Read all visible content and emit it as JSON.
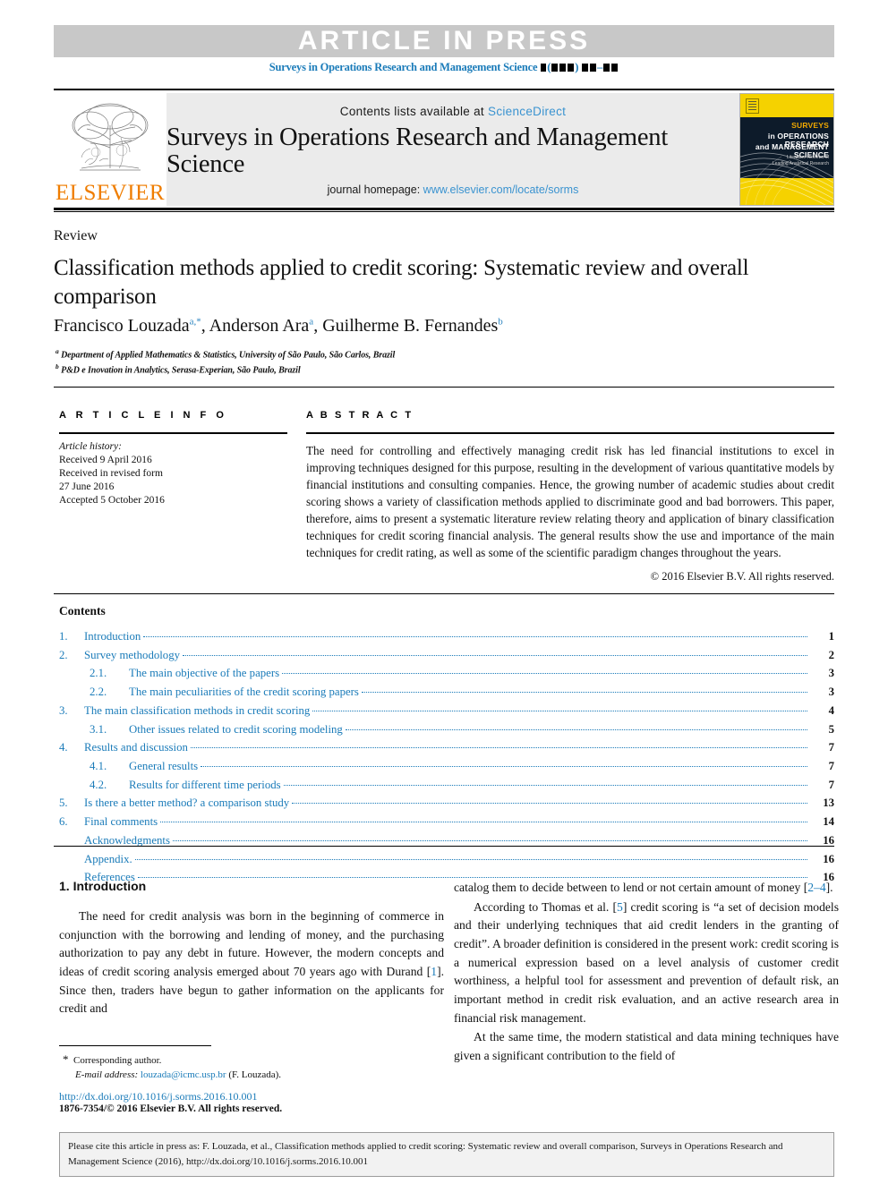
{
  "banner": {
    "text": "ARTICLE IN PRESS",
    "journal_ref_prefix": "Surveys in Operations Research and Management Science",
    "journal_ref_suffix_note": "volume/issue/page placeholders shown as black blocks",
    "band_color": "#c8c8c8",
    "link_color": "#1a7bb9"
  },
  "masthead": {
    "contents_available_prefix": "Contents lists available at ",
    "sciencedirect": "ScienceDirect",
    "journal_title": "Surveys in Operations Research and Management Science",
    "homepage_prefix": "journal homepage: ",
    "homepage_url": "www.elsevier.com/locate/sorms",
    "publisher": "ELSEVIER",
    "publisher_color": "#ef7d00",
    "cover": {
      "line1": "SURVEYS",
      "line2": "in OPERATIONS RESEARCH",
      "line3": "and MANAGEMENT SCIENCE",
      "subline1": "Literature Reviews of",
      "subline2": "Leading Analytical Research",
      "bg_color": "#f5d200",
      "band_color": "#0d1b2a"
    }
  },
  "article": {
    "type_label": "Review",
    "title": "Classification methods applied to credit scoring: Systematic review and overall comparison",
    "authors": [
      {
        "name": "Francisco Louzada",
        "marks": "a,*"
      },
      {
        "name": "Anderson Ara",
        "marks": "a"
      },
      {
        "name": "Guilherme B. Fernandes",
        "marks": "b"
      }
    ],
    "affiliations": [
      {
        "mark": "a",
        "text": "Department of Applied Mathematics & Statistics, University of São Paulo, São Carlos, Brazil"
      },
      {
        "mark": "b",
        "text": "P&D e Inovation in Analytics, Serasa-Experian, São Paulo, Brazil"
      }
    ]
  },
  "article_info": {
    "heading": "A R T I C L E  I N F O",
    "history_label": "Article history:",
    "lines": [
      "Received 9 April 2016",
      "Received in revised form",
      "27 June 2016",
      "Accepted 5 October 2016"
    ]
  },
  "abstract": {
    "heading": "A B S T R A C T",
    "text": "The need for controlling and effectively managing credit risk has led financial institutions to excel in improving techniques designed for this purpose, resulting in the development of various quantitative models by financial institutions and consulting companies. Hence, the growing number of academic studies about credit scoring shows a variety of classification methods applied to discriminate good and bad borrowers. This paper, therefore, aims to present a systematic literature review relating theory and application of binary classification techniques for credit scoring financial analysis. The general results show the use and importance of the main techniques for credit rating, as well as some of the scientific paradigm changes throughout the years.",
    "copyright": "© 2016 Elsevier B.V. All rights reserved."
  },
  "contents": {
    "heading": "Contents",
    "items": [
      {
        "num": "1.",
        "level": 1,
        "label": "Introduction",
        "page": "1"
      },
      {
        "num": "2.",
        "level": 1,
        "label": "Survey methodology",
        "page": "2"
      },
      {
        "num": "2.1.",
        "level": 2,
        "label": "The main objective of the papers",
        "page": "3"
      },
      {
        "num": "2.2.",
        "level": 2,
        "label": "The main peculiarities of the credit scoring papers",
        "page": "3"
      },
      {
        "num": "3.",
        "level": 1,
        "label": "The main classification methods in credit scoring",
        "page": "4"
      },
      {
        "num": "3.1.",
        "level": 2,
        "label": "Other issues related to credit scoring modeling",
        "page": "5"
      },
      {
        "num": "4.",
        "level": 1,
        "label": "Results and discussion",
        "page": "7"
      },
      {
        "num": "4.1.",
        "level": 2,
        "label": "General results",
        "page": "7"
      },
      {
        "num": "4.2.",
        "level": 2,
        "label": "Results for different time periods",
        "page": "7"
      },
      {
        "num": "5.",
        "level": 1,
        "label": "Is there a better method? a comparison study",
        "page": "13"
      },
      {
        "num": "6.",
        "level": 1,
        "label": "Final comments",
        "page": "14"
      },
      {
        "num": "",
        "level": 1,
        "label": "Acknowledgments",
        "page": "16"
      },
      {
        "num": "",
        "level": 1,
        "label": "Appendix.",
        "page": "16"
      },
      {
        "num": "",
        "level": 1,
        "label": "References",
        "page": "16"
      }
    ]
  },
  "body": {
    "section_heading": "1. Introduction",
    "left_paragraph_1_a": "The need for credit analysis was born in the beginning of commerce in conjunction with the borrowing and lending of money, and the purchasing authorization to pay any debt in future. However, the modern concepts and ideas of credit scoring analysis emerged about 70 years ago with Durand [",
    "left_paragraph_1_ref": "1",
    "left_paragraph_1_b": "]. Since then, traders have begun to gather information on the applicants for credit and",
    "right_paragraph_1_a": "catalog them to decide between to lend or not certain amount of money [",
    "right_paragraph_1_ref": "2–4",
    "right_paragraph_1_b": "].",
    "right_paragraph_2_a": "According to Thomas et al. [",
    "right_paragraph_2_ref": "5",
    "right_paragraph_2_b": "] credit scoring is “a set of decision models and their underlying techniques that aid credit lenders in the granting of credit”. A broader definition is considered in the present work: credit scoring is a numerical expression based on a level analysis of customer credit worthiness, a helpful tool for assessment and prevention of default risk, an important method in credit risk evaluation, and an active research area in financial risk management.",
    "right_paragraph_3": "At the same time, the modern statistical and data mining techniques have given a significant contribution to the field of"
  },
  "footer": {
    "corresponding_author": "Corresponding author.",
    "email_label": "E-mail address:",
    "email": "louzada@icmc.usp.br",
    "email_owner": "(F. Louzada).",
    "doi": "http://dx.doi.org/10.1016/j.sorms.2016.10.001",
    "issn_line": "1876-7354/© 2016 Elsevier B.V. All rights reserved."
  },
  "cite_box": {
    "text": "Please cite this article in press as: F. Louzada, et al., Classification methods applied to credit scoring: Systematic review and overall comparison, Surveys in Operations Research and Management Science (2016), http://dx.doi.org/10.1016/j.sorms.2016.10.001"
  }
}
